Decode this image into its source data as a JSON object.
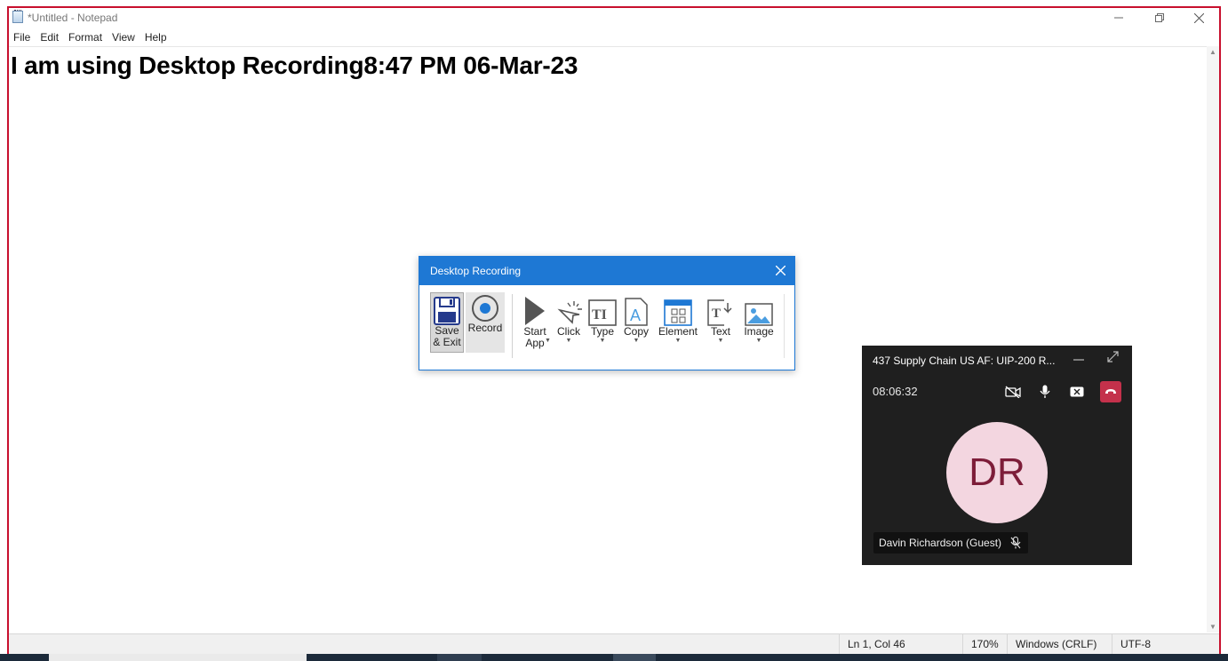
{
  "notepad": {
    "title": "*Untitled - Notepad",
    "menu": {
      "file": "File",
      "edit": "Edit",
      "format": "Format",
      "view": "View",
      "help": "Help"
    },
    "content": "I am using Desktop Recording8:47 PM 06-Mar-23",
    "status": {
      "position": "Ln 1, Col 46",
      "zoom": "170%",
      "line_ending": "Windows (CRLF)",
      "encoding": "UTF-8"
    }
  },
  "recorder": {
    "title": "Desktop Recording",
    "tools": {
      "save_exit_1": "Save",
      "save_exit_2": "& Exit",
      "record": "Record",
      "start_app_1": "Start",
      "start_app_2": "App",
      "click": "Click",
      "type": "Type",
      "copy": "Copy",
      "element": "Element",
      "text": "Text",
      "image": "Image"
    }
  },
  "call": {
    "meeting_name": "437 Supply Chain US AF: UIP-200 R...",
    "timer": "08:06:32",
    "avatar_initials": "DR",
    "participant": "Davin Richardson (Guest)",
    "accent_color": "#c4314b"
  }
}
